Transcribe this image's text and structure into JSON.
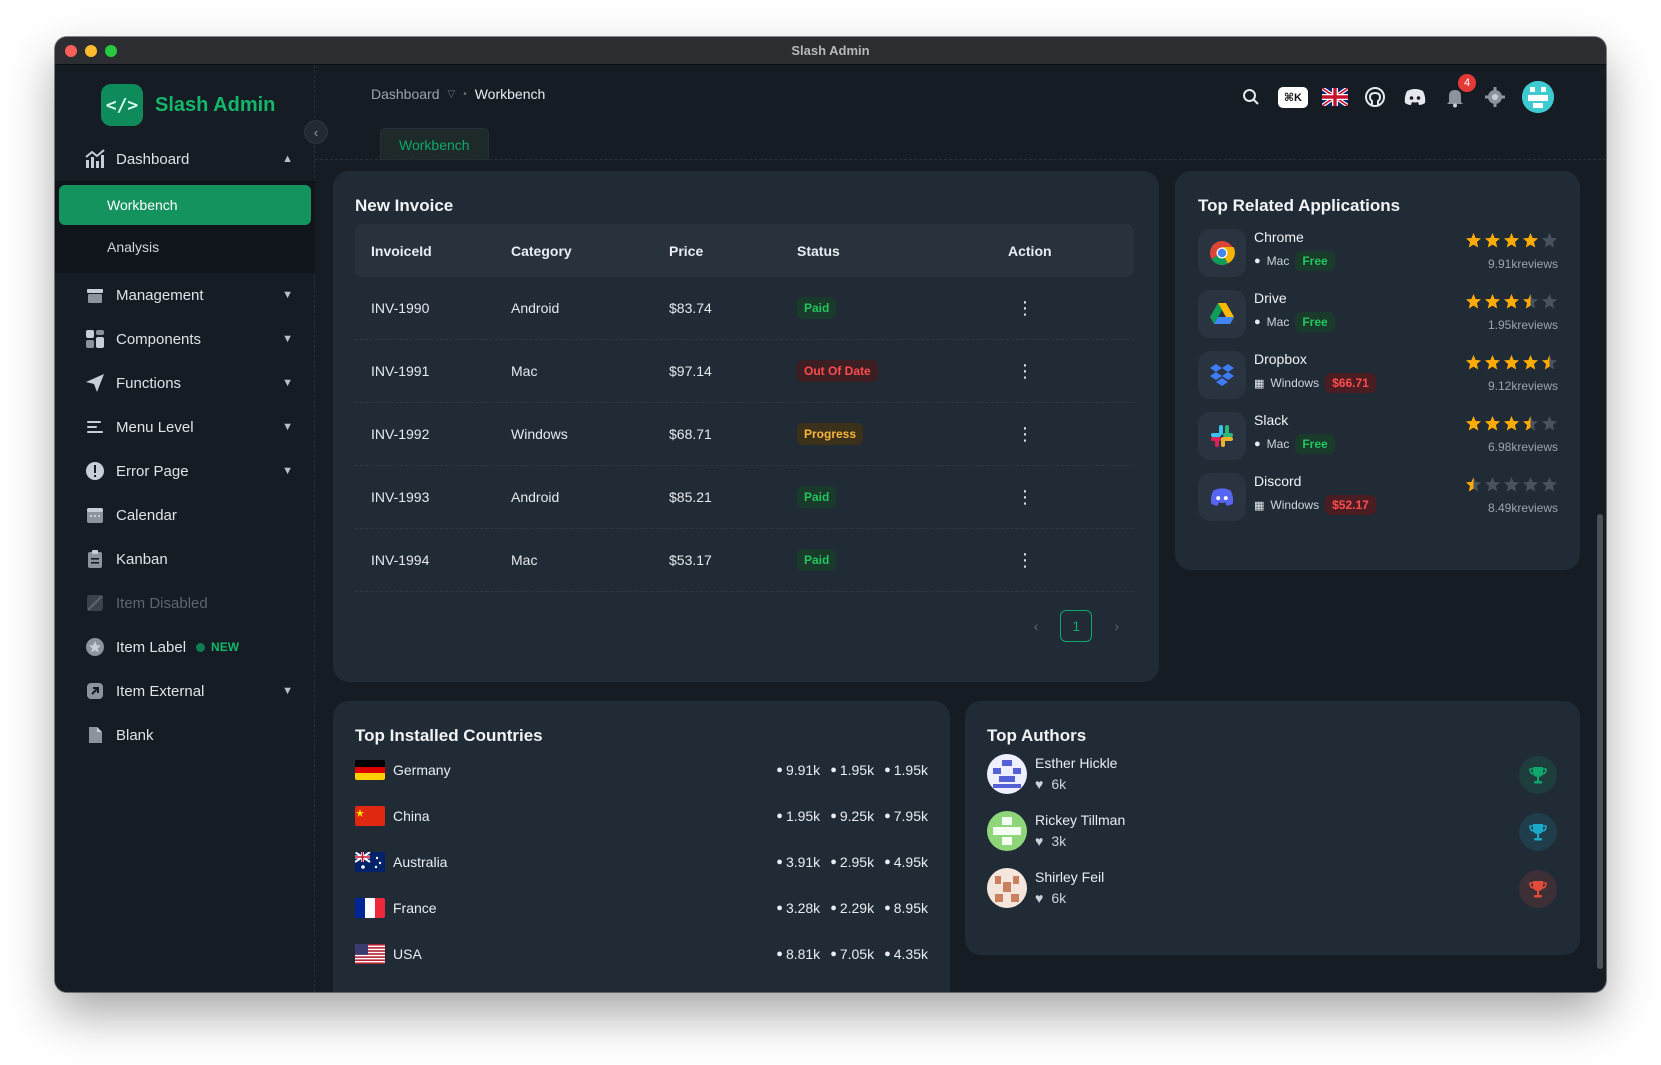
{
  "window": {
    "title": "Slash Admin"
  },
  "brand": {
    "name": "Slash Admin",
    "logo_icon": "code-brackets-icon",
    "color": "#12b76a"
  },
  "sidebar": {
    "dashboard": {
      "label": "Dashboard",
      "icon": "chart-icon"
    },
    "dashboard_children": [
      "Workbench",
      "Analysis"
    ],
    "items": [
      {
        "label": "Management",
        "icon": "box-icon"
      },
      {
        "label": "Components",
        "icon": "grid-icon"
      },
      {
        "label": "Functions",
        "icon": "send-icon"
      },
      {
        "label": "Menu Level",
        "icon": "menu-icon"
      },
      {
        "label": "Error Page",
        "icon": "alert-icon"
      },
      {
        "label": "Calendar",
        "icon": "calendar-icon"
      },
      {
        "label": "Kanban",
        "icon": "clipboard-icon"
      },
      {
        "label": "Item Disabled",
        "icon": "disabled-icon"
      },
      {
        "label": "Item Label",
        "icon": "star-icon",
        "badge": "NEW"
      },
      {
        "label": "Item External",
        "icon": "external-link-icon"
      },
      {
        "label": "Blank",
        "icon": "file-icon"
      }
    ]
  },
  "header": {
    "breadcrumb": [
      "Dashboard",
      "Workbench"
    ],
    "search_shortcut": "⌘K",
    "notification_count": "4"
  },
  "tabs": [
    "Workbench"
  ],
  "invoice": {
    "title": "New Invoice",
    "columns": [
      "InvoiceId",
      "Category",
      "Price",
      "Status",
      "Action"
    ],
    "rows": [
      {
        "id": "INV-1990",
        "category": "Android",
        "price": "$83.74",
        "status": "Paid"
      },
      {
        "id": "INV-1991",
        "category": "Mac",
        "price": "$97.14",
        "status": "Out Of Date"
      },
      {
        "id": "INV-1992",
        "category": "Windows",
        "price": "$68.71",
        "status": "Progress"
      },
      {
        "id": "INV-1993",
        "category": "Android",
        "price": "$85.21",
        "status": "Paid"
      },
      {
        "id": "INV-1994",
        "category": "Mac",
        "price": "$53.17",
        "status": "Paid"
      }
    ],
    "pagination": {
      "current": "1"
    }
  },
  "apps": {
    "title": "Top Related Applications",
    "items": [
      {
        "name": "Chrome",
        "platform": "Mac",
        "price": "Free",
        "rating": 4,
        "reviews": "9.91kreviews"
      },
      {
        "name": "Drive",
        "platform": "Mac",
        "price": "Free",
        "rating": 3.5,
        "reviews": "1.95kreviews"
      },
      {
        "name": "Dropbox",
        "platform": "Windows",
        "price": "$66.71",
        "rating": 4.5,
        "reviews": "9.12kreviews"
      },
      {
        "name": "Slack",
        "platform": "Mac",
        "price": "Free",
        "rating": 3.5,
        "reviews": "6.98kreviews"
      },
      {
        "name": "Discord",
        "platform": "Windows",
        "price": "$52.17",
        "rating": 0.5,
        "reviews": "8.49kreviews"
      }
    ]
  },
  "countries": {
    "title": "Top Installed Countries",
    "rows": [
      {
        "name": "Germany",
        "stats": [
          "9.91k",
          "1.95k",
          "1.95k"
        ]
      },
      {
        "name": "China",
        "stats": [
          "1.95k",
          "9.25k",
          "7.95k"
        ]
      },
      {
        "name": "Australia",
        "stats": [
          "3.91k",
          "2.95k",
          "4.95k"
        ]
      },
      {
        "name": "France",
        "stats": [
          "3.28k",
          "2.29k",
          "8.95k"
        ]
      },
      {
        "name": "USA",
        "stats": [
          "8.81k",
          "7.05k",
          "4.35k"
        ]
      }
    ]
  },
  "authors": {
    "title": "Top Authors",
    "rows": [
      {
        "name": "Esther Hickle",
        "likes": "6k",
        "trophy_color": "#0fa66b"
      },
      {
        "name": "Rickey Tillman",
        "likes": "3k",
        "trophy_color": "#1ca9c9"
      },
      {
        "name": "Shirley Feil",
        "likes": "6k",
        "trophy_color": "#e04b3a"
      }
    ]
  }
}
